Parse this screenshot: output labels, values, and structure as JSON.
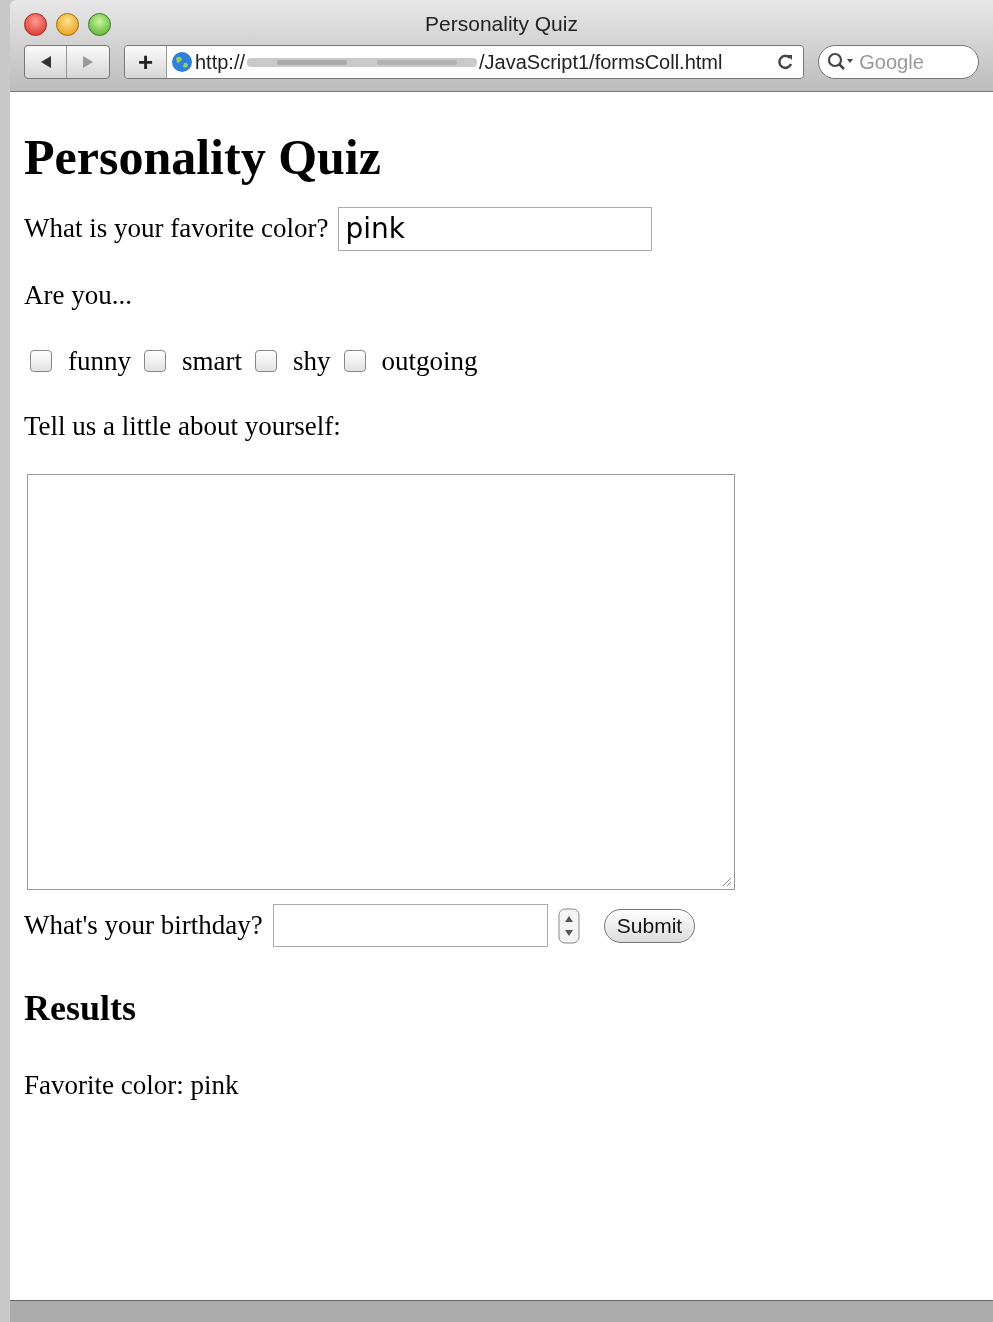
{
  "window": {
    "title": "Personality Quiz"
  },
  "toolbar": {
    "add_button": "+",
    "url_start": "http://",
    "url_end": "/JavaScript1/formsColl.html",
    "search_placeholder": "Google"
  },
  "heading": "Personality Quiz",
  "color_question": {
    "label": "What is your favorite color?",
    "value": "pink"
  },
  "traits_prompt": "Are you...",
  "traits": [
    {
      "label": "funny",
      "checked": false
    },
    {
      "label": "smart",
      "checked": false
    },
    {
      "label": "shy",
      "checked": false
    },
    {
      "label": "outgoing",
      "checked": false
    }
  ],
  "about_prompt": "Tell us a little about yourself:",
  "birthday": {
    "label": "What's your birthday?"
  },
  "submit_button": "Submit",
  "results": {
    "heading": "Results",
    "lines": [
      "Favorite color: pink"
    ]
  }
}
